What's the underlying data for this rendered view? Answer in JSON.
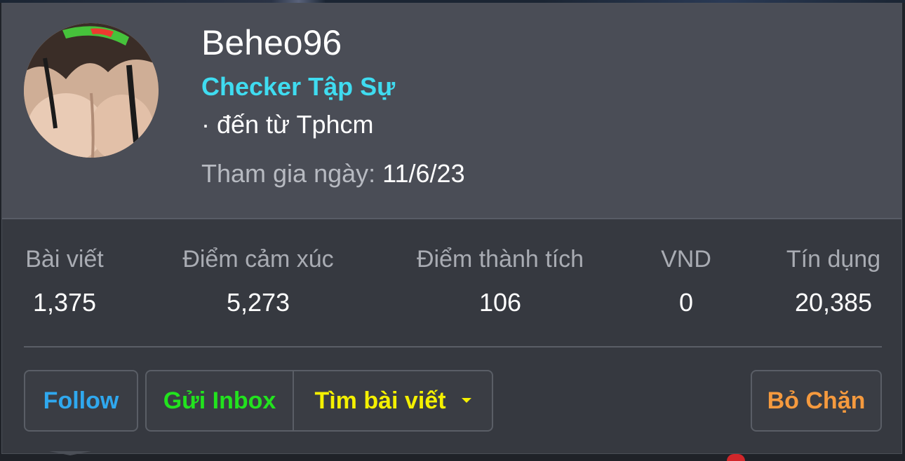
{
  "profile": {
    "username": "Beheo96",
    "rank": "Checker Tập Sự",
    "location": "· đến từ Tphcm",
    "joined_label": "Tham gia ngày:",
    "joined_value": "11/6/23",
    "avatar_icon": "user-avatar-photo"
  },
  "stats": [
    {
      "label": "Bài viết",
      "value": "1,375"
    },
    {
      "label": "Điểm cảm xúc",
      "value": "5,273"
    },
    {
      "label": "Điểm thành tích",
      "value": "106"
    },
    {
      "label": "VND",
      "value": "0"
    },
    {
      "label": "Tín dụng",
      "value": "20,385"
    }
  ],
  "actions": {
    "follow": "Follow",
    "inbox": "Gửi Inbox",
    "find_posts": "Tìm bài viết",
    "unblock": "Bỏ Chặn"
  },
  "colors": {
    "rank": "#3fdcf0",
    "follow": "#2fa8ee",
    "inbox": "#22e31e",
    "find_posts": "#f4f000",
    "unblock": "#f59a3e",
    "header_bg": "#4a4d56",
    "body_bg": "#363940"
  }
}
